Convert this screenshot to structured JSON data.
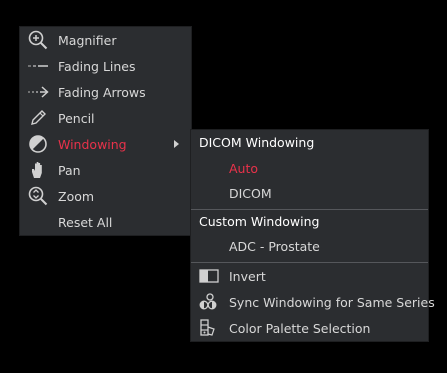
{
  "main_menu": {
    "items": [
      {
        "label": "Magnifier",
        "icon": "magnifier-icon"
      },
      {
        "label": "Fading Lines",
        "icon": "fading-lines-icon"
      },
      {
        "label": "Fading Arrows",
        "icon": "fading-arrow-icon"
      },
      {
        "label": "Pencil",
        "icon": "pencil-icon"
      },
      {
        "label": "Windowing",
        "icon": "windowing-icon",
        "active": true,
        "has_submenu": true
      },
      {
        "label": "Pan",
        "icon": "hand-icon"
      },
      {
        "label": "Zoom",
        "icon": "zoom-icon"
      },
      {
        "label": "Reset All",
        "icon": ""
      }
    ]
  },
  "sub_menu": {
    "dicom_header": "DICOM Windowing",
    "auto_label": "Auto",
    "dicom_label": "DICOM",
    "custom_header": "Custom Windowing",
    "adc_label": "ADC - Prostate",
    "invert_label": "Invert",
    "sync_label": "Sync Windowing for Same Series",
    "palette_label": "Color Palette Selection"
  },
  "colors": {
    "background": "#000000",
    "menu_bg": "#2b2d30",
    "text": "#d8d8d8",
    "active": "#e8324a",
    "header": "#ffffff"
  }
}
